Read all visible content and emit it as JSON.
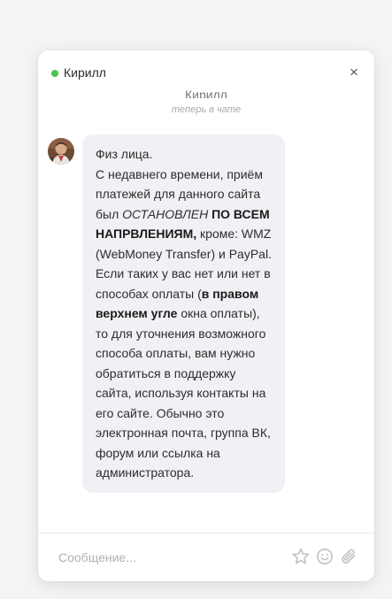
{
  "header": {
    "contact_name": "Кирилл",
    "close_glyph": "×",
    "status_color": "#4cc24f"
  },
  "agent": {
    "name": "Кирилл",
    "status": "теперь в чате"
  },
  "message": {
    "p1": "Физ лица.",
    "t1": "С недавнего времени, приём платежей для данного сайта был ",
    "t2": "ОСТАНОВЛЕН",
    "t3": " ",
    "t4": "ПО ВСЕМ НАПРВЛЕНИЯМ,",
    "t5": " кроме: WMZ (WebMoney Transfer) и PayPal. Если таких у вас нет или нет в способах оплаты (",
    "t6": "в правом верхнем угле",
    "t7": " окна оплаты), то для уточнения возможного способа оплаты, вам нужно обратиться в поддержку сайта, используя контакты на его сайте. Обычно это электронная почта, группа ВК, форум или ссылка на администратора."
  },
  "input": {
    "placeholder": "Сообщение..."
  },
  "icons": [
    "star-icon",
    "smile-icon",
    "paperclip-icon"
  ]
}
